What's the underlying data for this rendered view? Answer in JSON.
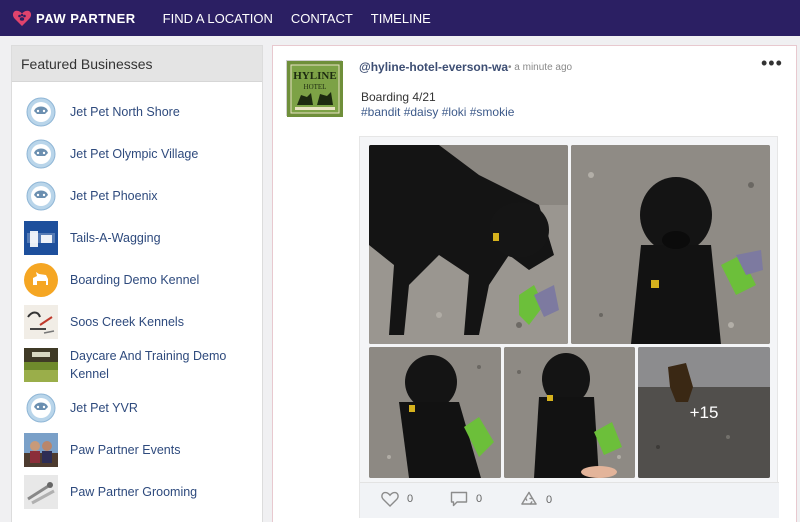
{
  "nav": {
    "brand": "PAW PARTNER",
    "links": [
      "FIND A LOCATION",
      "CONTACT",
      "TIMELINE"
    ]
  },
  "colors": {
    "nav_bg": "#2b1f63",
    "link": "#2e4a7d",
    "brand_heart": "#e0436d"
  },
  "sidebar": {
    "title": "Featured Businesses",
    "items": [
      {
        "name": "Jet Pet North Shore",
        "logo": "jet-pet-logo"
      },
      {
        "name": "Jet Pet Olympic Village",
        "logo": "jet-pet-logo"
      },
      {
        "name": "Jet Pet Phoenix",
        "logo": "jet-pet-logo"
      },
      {
        "name": "Tails-A-Wagging",
        "logo": "tails-logo"
      },
      {
        "name": "Boarding Demo Kennel",
        "logo": "dog-circle-logo"
      },
      {
        "name": "Soos Creek Kennels",
        "logo": "soos-creek-logo"
      },
      {
        "name": "Daycare And Training Demo Kennel",
        "logo": "field-photo-logo"
      },
      {
        "name": "Jet Pet YVR",
        "logo": "jet-pet-logo"
      },
      {
        "name": "Paw Partner Events",
        "logo": "people-photo-logo"
      },
      {
        "name": "Paw Partner Grooming",
        "logo": "grooming-photo-logo"
      }
    ]
  },
  "post": {
    "handle": "@hyline-hotel-everson-wa",
    "time": "• a minute ago",
    "avatar_text": "HYLINE",
    "avatar_sub": "HOTEL",
    "caption": "Boarding 4/21",
    "tags": "#bandit #daisy #loki #smokie",
    "more_photos": "+15",
    "likes": "0",
    "comments": "0",
    "shares": "0"
  }
}
